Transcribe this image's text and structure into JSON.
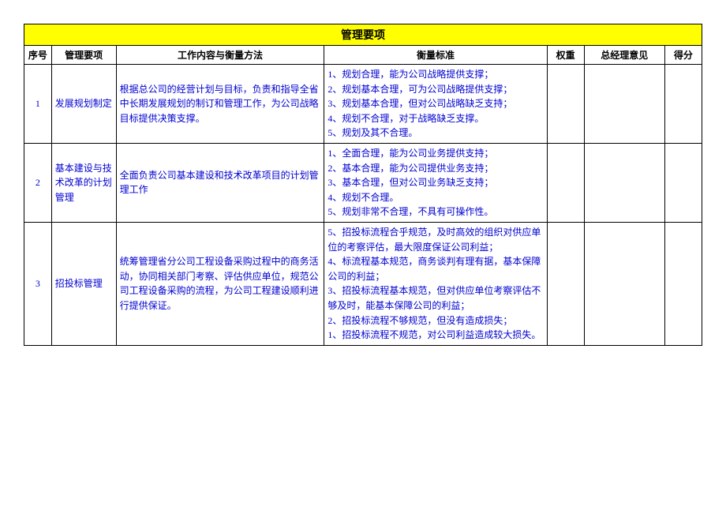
{
  "title": "管理要项",
  "headers": {
    "seq": "序号",
    "item": "管理要项",
    "work": "工作内容与衡量方法",
    "std": "衡量标准",
    "weight": "权重",
    "gm": "总经理意见",
    "score": "得分"
  },
  "rows": [
    {
      "seq": "1",
      "item": "发展规划制定",
      "work": "根据总公司的经营计划与目标，负责和指导全省中长期发展规划的制订和管理工作，为公司战略目标提供决策支撑。",
      "std": "1、规划合理，能为公司战略提供支撑；\n2、规划基本合理，可为公司战略提供支撑；\n3、规划基本合理，但对公司战略缺乏支持；\n4、规划不合理，对于战略缺乏支撑。\n5、规划及其不合理。",
      "weight": "",
      "gm": "",
      "score": ""
    },
    {
      "seq": "2",
      "item": "基本建设与技术改革的计划管理",
      "work": "全面负责公司基本建设和技术改革项目的计划管理工作",
      "std": "1、全面合理，能为公司业务提供支持；\n2、基本合理，能为公司提供业务支持；\n3、基本合理，但对公司业务缺乏支持；\n4、规划不合理。\n5、规划非常不合理，不具有可操作性。",
      "weight": "",
      "gm": "",
      "score": ""
    },
    {
      "seq": "3",
      "item": "招投标管理",
      "work": "统筹管理省分公司工程设备采购过程中的商务活动，协同相关部门考察、评估供应单位，规范公司工程设备采购的流程，为公司工程建设顺利进行提供保证。",
      "std": "5、招投标流程合乎规范，及时高效的组织对供应单位的考察评估，最大限度保证公司利益；\n4、标流程基本规范，商务谈判有理有据，基本保障公司的利益；\n3、招投标流程基本规范，但对供应单位考察评估不够及时，能基本保障公司的利益；\n2、招投标流程不够规范，但没有造成损失；\n1、招投标流程不规范，对公司利益造成较大损失。",
      "weight": "",
      "gm": "",
      "score": ""
    }
  ]
}
